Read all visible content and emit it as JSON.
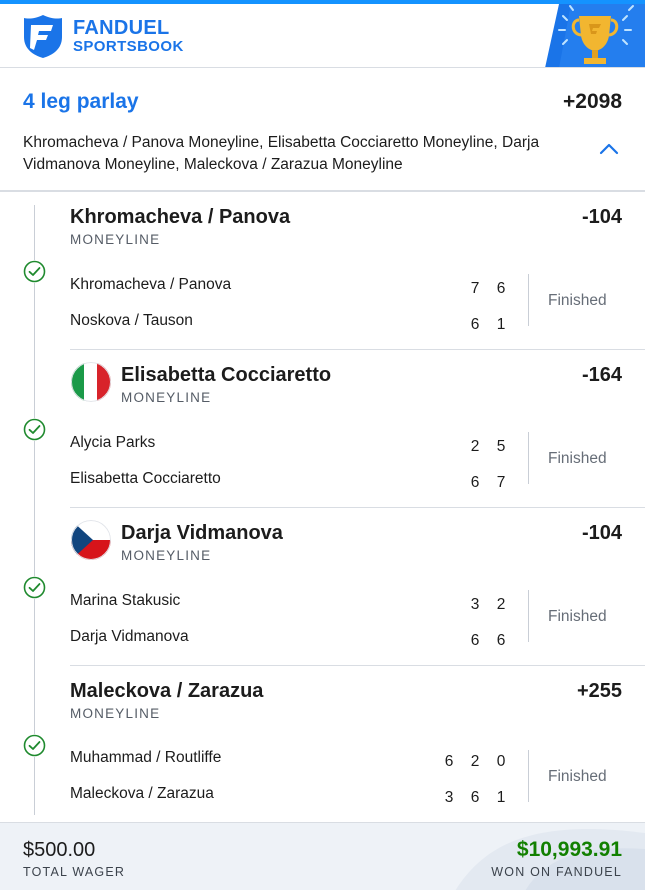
{
  "header": {
    "brand_line1": "FANDUEL",
    "brand_line2": "SPORTSBOOK",
    "logo_icon": "fanduel-shield-icon",
    "badge_icon": "trophy-icon"
  },
  "parlay": {
    "title": "4 leg parlay",
    "odds": "+2098",
    "description": "Khromacheva / Panova Moneyline, Elisabetta Cocciaretto Moneyline, Darja Vidmanova Moneyline, Maleckova / Zarazua Moneyline",
    "toggle_icon": "chevron-up-icon"
  },
  "legs": [
    {
      "selection": "Khromacheva / Panova",
      "odds": "-104",
      "market": "MONEYLINE",
      "flag": null,
      "status": "Finished",
      "rows": [
        {
          "team": "Khromacheva / Panova",
          "scores": [
            "7",
            "6"
          ]
        },
        {
          "team": "Noskova / Tauson",
          "scores": [
            "6",
            "1"
          ]
        }
      ]
    },
    {
      "selection": "Elisabetta Cocciaretto",
      "odds": "-164",
      "market": "MONEYLINE",
      "flag": "italy-flag-icon",
      "status": "Finished",
      "rows": [
        {
          "team": "Alycia Parks",
          "scores": [
            "2",
            "5"
          ]
        },
        {
          "team": "Elisabetta Cocciaretto",
          "scores": [
            "6",
            "7"
          ]
        }
      ]
    },
    {
      "selection": "Darja Vidmanova",
      "odds": "-104",
      "market": "MONEYLINE",
      "flag": "czech-flag-icon",
      "status": "Finished",
      "rows": [
        {
          "team": "Marina Stakusic",
          "scores": [
            "3",
            "2"
          ]
        },
        {
          "team": "Darja Vidmanova",
          "scores": [
            "6",
            "6"
          ]
        }
      ]
    },
    {
      "selection": "Maleckova / Zarazua",
      "odds": "+255",
      "market": "MONEYLINE",
      "flag": null,
      "status": "Finished",
      "rows": [
        {
          "team": "Muhammad / Routliffe",
          "scores": [
            "6",
            "2",
            "0"
          ]
        },
        {
          "team": "Maleckova / Zarazua",
          "scores": [
            "3",
            "6",
            "1"
          ]
        }
      ]
    }
  ],
  "footer": {
    "wager_amount": "$500.00",
    "wager_label": "TOTAL WAGER",
    "won_amount": "$10,993.91",
    "won_label": "WON ON FANDUEL"
  },
  "colors": {
    "brand_blue": "#1a74e8",
    "win_green": "#128000",
    "check_green": "#1f8a2e"
  }
}
